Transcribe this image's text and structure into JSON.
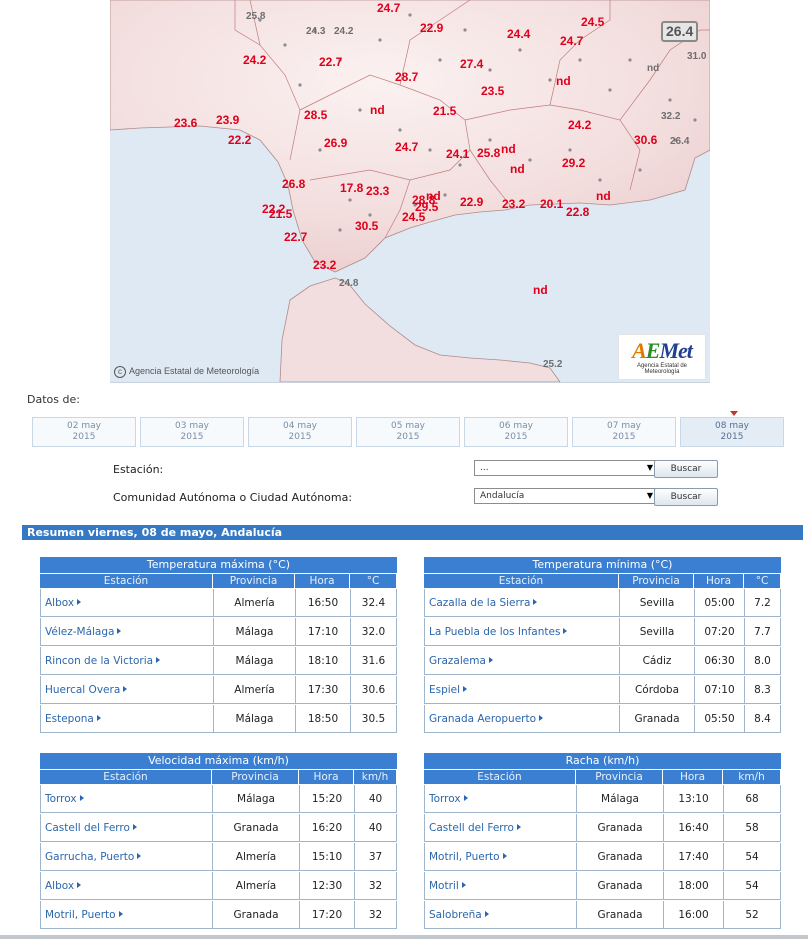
{
  "map": {
    "copyright": "Agencia Estatal de Meteorología",
    "logo_text": "AEMet",
    "logo_subtitle": "Agencia Estatal de Meteorología",
    "labels_red": [
      "24.7",
      "22.9",
      "24.4",
      "24.5",
      "24.7",
      "24.2",
      "22.7",
      "28.7",
      "27.4",
      "23.5",
      "nd",
      "23.6",
      "23.9",
      "28.5",
      "nd",
      "21.5",
      "24.2",
      "22.2",
      "26.9",
      "24.7",
      "24.1",
      "25.8",
      "nd",
      "30.6",
      "nd",
      "29.2",
      "26.8",
      "17.8",
      "23.3",
      "28.8",
      "nd",
      "22.2",
      "29.5",
      "22.9",
      "23.2",
      "20.1",
      "22.8",
      "nd",
      "21.5",
      "24.5",
      "30.5",
      "22.7",
      "23.2",
      "nd"
    ],
    "labels_grey": [
      "25.8",
      "24.3",
      "24.2",
      "nd",
      "31.0",
      "32.2",
      "26.4",
      "24.8",
      "25.2"
    ],
    "highlight": "26.4"
  },
  "dates": {
    "label": "Datos de:",
    "tabs": [
      {
        "day": "02 may",
        "year": "2015"
      },
      {
        "day": "03 may",
        "year": "2015"
      },
      {
        "day": "04 may",
        "year": "2015"
      },
      {
        "day": "05 may",
        "year": "2015"
      },
      {
        "day": "06 may",
        "year": "2015"
      },
      {
        "day": "07 may",
        "year": "2015"
      },
      {
        "day": "08 may",
        "year": "2015"
      }
    ]
  },
  "form": {
    "station_label": "Estación:",
    "station_value": "...",
    "region_label": "Comunidad Autónoma o Ciudad Autónoma:",
    "region_value": "Andalucía",
    "search_label": "Buscar"
  },
  "summary": {
    "title": "Resumen viernes, 08 de mayo, Andalucía",
    "tmax": {
      "title": "Temperatura máxima (°C)",
      "headers": [
        "Estación",
        "Provincia",
        "Hora",
        "°C"
      ],
      "rows": [
        [
          "Albox",
          "Almería",
          "16:50",
          "32.4"
        ],
        [
          "Vélez-Málaga",
          "Málaga",
          "17:10",
          "32.0"
        ],
        [
          "Rincon de la Victoria",
          "Málaga",
          "18:10",
          "31.6"
        ],
        [
          "Huercal Overa",
          "Almería",
          "17:30",
          "30.6"
        ],
        [
          "Estepona",
          "Málaga",
          "18:50",
          "30.5"
        ]
      ]
    },
    "tmin": {
      "title": "Temperatura mínima (°C)",
      "headers": [
        "Estación",
        "Provincia",
        "Hora",
        "°C"
      ],
      "rows": [
        [
          "Cazalla de la Sierra",
          "Sevilla",
          "05:00",
          "7.2"
        ],
        [
          "La Puebla de los Infantes",
          "Sevilla",
          "07:20",
          "7.7"
        ],
        [
          "Grazalema",
          "Cádiz",
          "06:30",
          "8.0"
        ],
        [
          "Espiel",
          "Córdoba",
          "07:10",
          "8.3"
        ],
        [
          "Granada Aeropuerto",
          "Granada",
          "05:50",
          "8.4"
        ]
      ]
    },
    "wind": {
      "title": "Velocidad máxima (km/h)",
      "headers": [
        "Estación",
        "Provincia",
        "Hora",
        "km/h"
      ],
      "rows": [
        [
          "Torrox",
          "Málaga",
          "15:20",
          "40"
        ],
        [
          "Castell del Ferro",
          "Granada",
          "16:20",
          "40"
        ],
        [
          "Garrucha, Puerto",
          "Almería",
          "15:10",
          "37"
        ],
        [
          "Albox",
          "Almería",
          "12:30",
          "32"
        ],
        [
          "Motril, Puerto",
          "Granada",
          "17:20",
          "32"
        ]
      ]
    },
    "gust": {
      "title": "Racha (km/h)",
      "headers": [
        "Estación",
        "Provincia",
        "Hora",
        "km/h"
      ],
      "rows": [
        [
          "Torrox",
          "Málaga",
          "13:10",
          "68"
        ],
        [
          "Castell del Ferro",
          "Granada",
          "16:40",
          "58"
        ],
        [
          "Motril, Puerto",
          "Granada",
          "17:40",
          "54"
        ],
        [
          "Motril",
          "Granada",
          "18:00",
          "54"
        ],
        [
          "Salobreña",
          "Granada",
          "16:00",
          "52"
        ]
      ]
    }
  }
}
